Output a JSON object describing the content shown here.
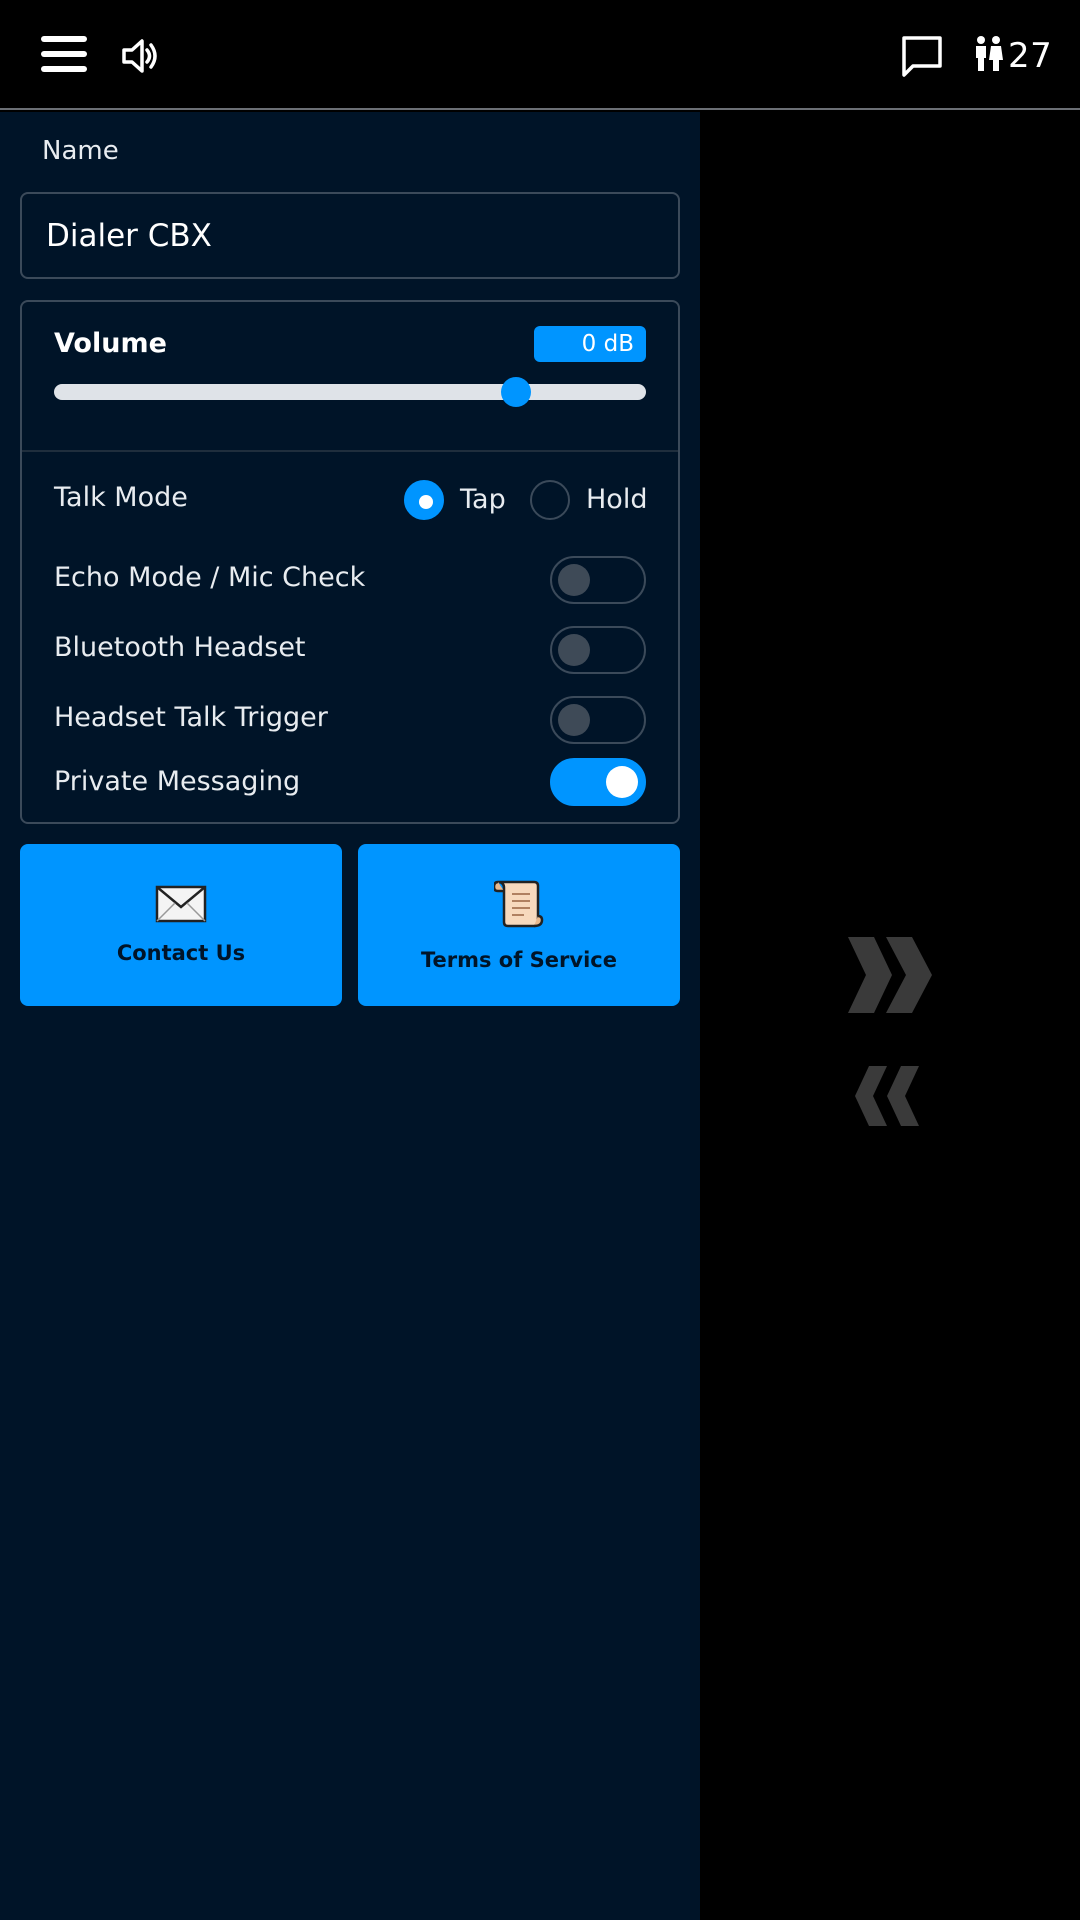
{
  "header": {
    "menu_icon": "hamburger-menu-icon",
    "speaker_icon": "speaker-icon",
    "chat_icon": "chat-bubble-icon",
    "users_icon": "people-icon",
    "user_count": "27"
  },
  "form": {
    "name_label": "Name",
    "name_value": "Dialer CBX"
  },
  "settings": {
    "volume_label": "Volume",
    "volume_value": "0 dB",
    "volume_slider_fraction": 0.78,
    "talk_mode_label": "Talk Mode",
    "talk_mode_options": [
      "Tap",
      "Hold"
    ],
    "talk_mode_selected": "Tap",
    "toggles": [
      {
        "label": "Echo Mode / Mic Check",
        "on": false
      },
      {
        "label": "Bluetooth Headset",
        "on": false
      },
      {
        "label": "Headset Talk Trigger",
        "on": false
      },
      {
        "label": "Private Messaging",
        "on": true
      }
    ]
  },
  "actions": {
    "contact_label": "Contact Us",
    "contact_icon": "envelope-icon",
    "terms_label": "Terms of Service",
    "terms_icon": "scroll-icon"
  },
  "side": {
    "forward_icon": "double-chevron-right-icon",
    "back_icon": "double-chevron-left-icon"
  },
  "colors": {
    "accent": "#0095ff",
    "panel_bg": "#001428",
    "chevron": "#3a3a3a"
  }
}
